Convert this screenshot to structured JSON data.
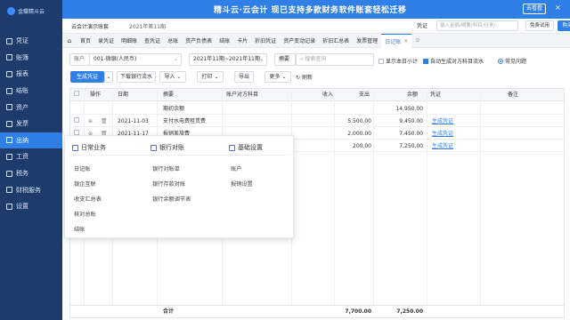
{
  "banner": {
    "ad_text": "精斗云·云会计 现已支持多款财务软件账套轻松迁移",
    "ad_button": "去看看",
    "close_label": "×"
  },
  "sidebar": {
    "logo_text": "金蝶精斗云",
    "items": [
      {
        "label": "凭证"
      },
      {
        "label": "账簿"
      },
      {
        "label": "报表"
      },
      {
        "label": "结账"
      },
      {
        "label": "资产"
      },
      {
        "label": "发票"
      },
      {
        "label": "出纳"
      },
      {
        "label": "工资"
      },
      {
        "label": "税务"
      },
      {
        "label": "财税服务"
      },
      {
        "label": "设置"
      }
    ]
  },
  "topbar": {
    "company": "云会计演示账套",
    "period": "2021年第11期",
    "voucher_select": "凭证",
    "search_placeholder": "输入金额/摘要/科目/往来/..",
    "trial_button": "免费试用",
    "buy_button": "购买"
  },
  "tabs": {
    "home_icon": "home-icon",
    "items": [
      {
        "label": "首页"
      },
      {
        "label": "录凭证"
      },
      {
        "label": "明细账"
      },
      {
        "label": "查凭证"
      },
      {
        "label": "总账"
      },
      {
        "label": "资产负债表"
      },
      {
        "label": "结账"
      },
      {
        "label": "卡片"
      },
      {
        "label": "折旧凭证"
      },
      {
        "label": "资产变动记录"
      },
      {
        "label": "折旧汇总表"
      },
      {
        "label": "发票管理"
      },
      {
        "label": "日记账"
      }
    ],
    "active_close": "×",
    "more_icon": "gear-icon"
  },
  "filters": {
    "account_label": "账户",
    "account_value": "001-微银(人民币)",
    "date_range": "2021年11期~2021年11期",
    "summary_label": "摘要",
    "search_placeholder": "搜索查询",
    "show_subtotal": "显示本日小计",
    "auto_voucher": "自动生成对方科目流水",
    "view_mode": "常见问题"
  },
  "toolbar": {
    "generate": "生成凭证",
    "import_bank": "下载银行流水",
    "import": "导入",
    "print": "打印",
    "export": "导出",
    "more": "更多",
    "refresh": "刷新"
  },
  "table": {
    "headers": [
      "操作",
      "日期",
      "摘要",
      "账户对方科目",
      "收入",
      "支出",
      "余额",
      "凭证",
      "备注"
    ],
    "rows": [
      {
        "date": "",
        "summary": "期初余额",
        "income": "",
        "expense": "",
        "balance": "14,950.00",
        "voucher": ""
      },
      {
        "date": "2021-11-03",
        "summary": "支付水电费租赁费",
        "income": "",
        "expense": "5,500.00",
        "balance": "9,450.00",
        "voucher": "生成凭证"
      },
      {
        "date": "2021-11-17",
        "summary": "报销差旅费",
        "income": "",
        "expense": "2,000.00",
        "balance": "7,450.00",
        "voucher": "生成凭证"
      },
      {
        "date": "",
        "summary": "",
        "income": "",
        "expense": "200.00",
        "balance": "7,250.00",
        "voucher": "生成凭证"
      }
    ],
    "total_label": "合计",
    "total_expense": "7,700.00",
    "total_balance": "7,250.00"
  },
  "mega_menu": {
    "columns": [
      {
        "title": "日常业务",
        "items": [
          "日记账",
          "银企互联",
          "收支汇总表",
          "核对总账",
          "结账"
        ]
      },
      {
        "title": "银行对账",
        "items": [
          "银行对账单",
          "银行存款对账",
          "银行余额调节表"
        ]
      },
      {
        "title": "基础设置",
        "items": [
          "账户",
          "报销设置"
        ]
      }
    ]
  },
  "colors": {
    "primary": "#2f7fe6",
    "sidebar": "#1d3c6c"
  }
}
